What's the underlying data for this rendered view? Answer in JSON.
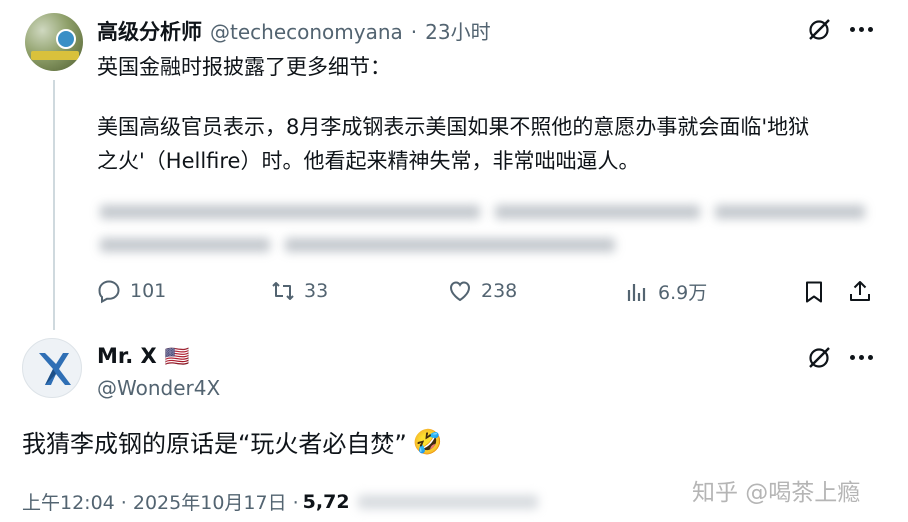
{
  "tweet1": {
    "display_name": "高级分析师",
    "handle": "@techeconomyana",
    "separator": "·",
    "time": "23小时",
    "line1": "英国金融时报披露了更多细节：",
    "line2": "美国高级官员表示，8月李成钢表示美国如果不照他的意愿办事就会面临'地狱",
    "line3": "之火'（Hellfire）时。他看起来精神失常，非常咄咄逼人。",
    "actions": {
      "reply_count": "101",
      "retweet_count": "33",
      "like_count": "238",
      "views_count": "6.9万"
    }
  },
  "tweet2": {
    "display_name": "Mr. X",
    "flag": "🇺🇸",
    "handle": "@Wonder4X",
    "text": "我猜李成钢的原话是“玩火者必自焚”",
    "emoji": "🤣",
    "timestamp": "上午12:04 · 2025年10月17日 ·",
    "views_partial": "5,72"
  },
  "watermark": "知乎 @喝茶上瘾",
  "icons": [
    "grok-icon",
    "more-icon",
    "reply-icon",
    "retweet-icon",
    "like-icon",
    "views-icon",
    "bookmark-icon",
    "share-icon"
  ],
  "colors": {
    "text": "#0f1419",
    "secondary": "#536471",
    "line": "#cfd9de"
  }
}
